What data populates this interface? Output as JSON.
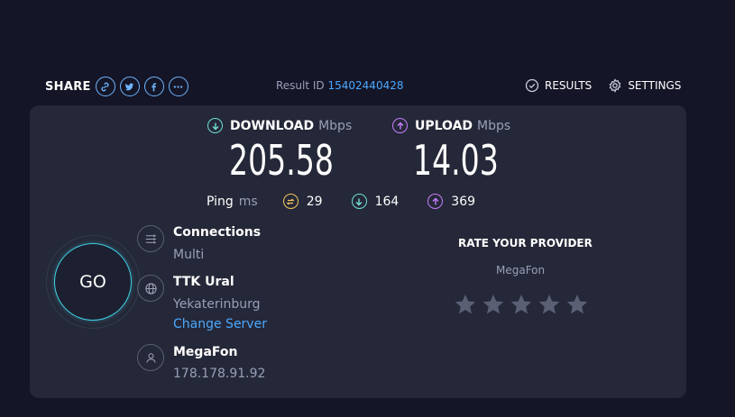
{
  "share": {
    "label": "SHARE",
    "icons": [
      "link-icon",
      "twitter-icon",
      "facebook-icon",
      "more-icon"
    ]
  },
  "result": {
    "label": "Result ID",
    "id": "15402440428"
  },
  "nav": {
    "results_label": "RESULTS",
    "settings_label": "SETTINGS"
  },
  "download": {
    "label": "DOWNLOAD",
    "unit": "Mbps",
    "value": "205.58"
  },
  "upload": {
    "label": "UPLOAD",
    "unit": "Mbps",
    "value": "14.03"
  },
  "ping": {
    "label": "Ping",
    "unit": "ms",
    "jitter": "29",
    "download_latency": "164",
    "upload_latency": "369"
  },
  "go": {
    "label": "GO"
  },
  "connections": {
    "title": "Connections",
    "value": "Multi"
  },
  "server": {
    "title": "TTK Ural",
    "location": "Yekaterinburg",
    "change_label": "Change Server"
  },
  "provider": {
    "title": "MegaFon",
    "ip": "178.178.91.92"
  },
  "rate": {
    "title": "RATE YOUR PROVIDER",
    "provider": "MegaFon",
    "stars": 5
  },
  "colors": {
    "background": "#141526",
    "card": "#252838",
    "accent_link": "#4aa8ff",
    "download": "#6fe0d4",
    "upload": "#c77dff",
    "jitter": "#f3c55d",
    "go_ring": "#3fd1e6"
  }
}
